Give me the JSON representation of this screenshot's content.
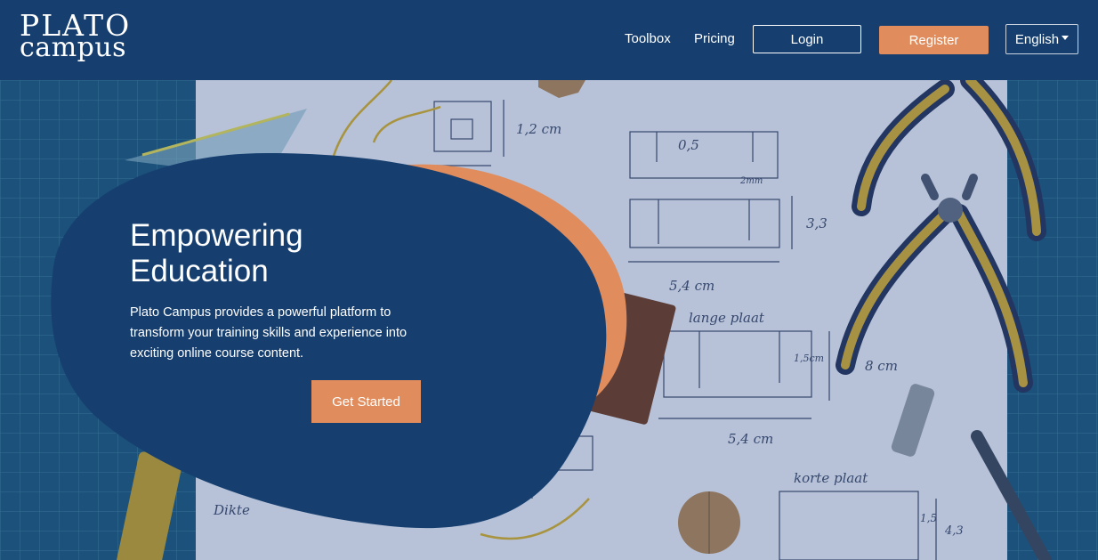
{
  "brand": {
    "line1": "PLATO",
    "line2": "campus"
  },
  "nav": {
    "toolbox": "Toolbox",
    "pricing": "Pricing",
    "login": "Login",
    "register": "Register",
    "language": "English"
  },
  "hero": {
    "title_line1": "Empowering",
    "title_line2": "Education",
    "description": "Plato Campus provides a powerful platform to transform your training skills and experience into exciting online course content.",
    "cta_label": "Get Started"
  },
  "sketch_labels": {
    "a": "1,2 cm",
    "b": "0,5",
    "c": "2mm",
    "d": "3,3",
    "e": "5,4 cm",
    "f": "lange plaat",
    "g": "1,5cm",
    "h": "8 cm",
    "i": "5,4 cm",
    "j": "korte plaat",
    "k": "4,3",
    "l": "1,5",
    "m": "Dikte"
  },
  "colors": {
    "navy": "#163f70",
    "accent": "#e08c5c",
    "white": "#ffffff"
  }
}
